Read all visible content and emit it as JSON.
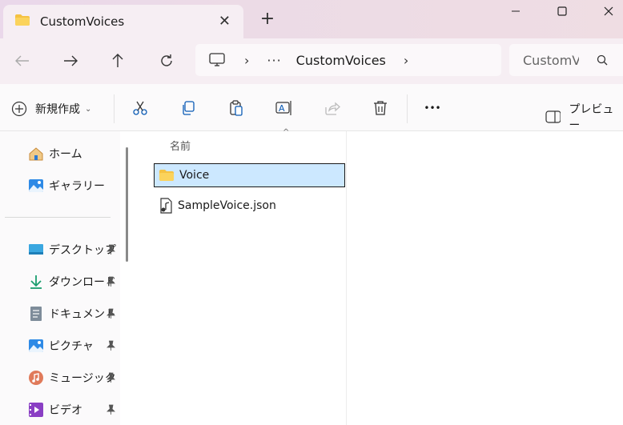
{
  "window": {
    "tab_title": "CustomVoices",
    "tab_close_glyph": "✕",
    "new_tab_glyph": "+",
    "controls": {
      "minimize": "minimize-icon",
      "maximize": "maximize-icon",
      "close": "close-icon"
    }
  },
  "navigation": {
    "back": "back-arrow-icon",
    "forward": "forward-arrow-icon",
    "up": "up-arrow-icon",
    "refresh": "refresh-icon"
  },
  "address": {
    "root_icon": "this-pc-icon",
    "sep1": "›",
    "overflow": "···",
    "crumb": "CustomVoices",
    "sep2": "›"
  },
  "search": {
    "placeholder": "CustomVoices の検索",
    "visible_text": "CustomV"
  },
  "toolbar": {
    "new_label": "新規作成",
    "new_chevron": "⌄",
    "buttons": [
      "cut-icon",
      "copy-icon",
      "paste-icon",
      "rename-icon",
      "share-icon",
      "delete-icon",
      "more-icon"
    ],
    "more_glyph": "•••",
    "preview_label": "プレビュー"
  },
  "sidebar": {
    "items": [
      {
        "label": "ホーム",
        "icon": "home-icon"
      },
      {
        "label": "ギャラリー",
        "icon": "gallery-icon"
      },
      {
        "label": "デスクトップ",
        "icon": "desktop-icon",
        "pinned": true
      },
      {
        "label": "ダウンロード",
        "icon": "download-icon",
        "pinned": true
      },
      {
        "label": "ドキュメント",
        "icon": "documents-icon",
        "pinned": true
      },
      {
        "label": "ピクチャ",
        "icon": "pictures-icon",
        "pinned": true
      },
      {
        "label": "ミュージック",
        "icon": "music-icon",
        "pinned": true
      },
      {
        "label": "ビデオ",
        "icon": "videos-icon",
        "pinned": true
      }
    ],
    "pin_glyph": "📌"
  },
  "files": {
    "column_name": "名前",
    "sort_caret": "^",
    "items": [
      {
        "name": "Voice",
        "type": "folder",
        "selected": true
      },
      {
        "name": "SampleVoice.json",
        "type": "json-file",
        "selected": false
      }
    ]
  },
  "colors": {
    "accent_selection": "#cce8ff",
    "folder_yellow": "#f5c242",
    "titlebar_tint": "#ecdbe6"
  }
}
